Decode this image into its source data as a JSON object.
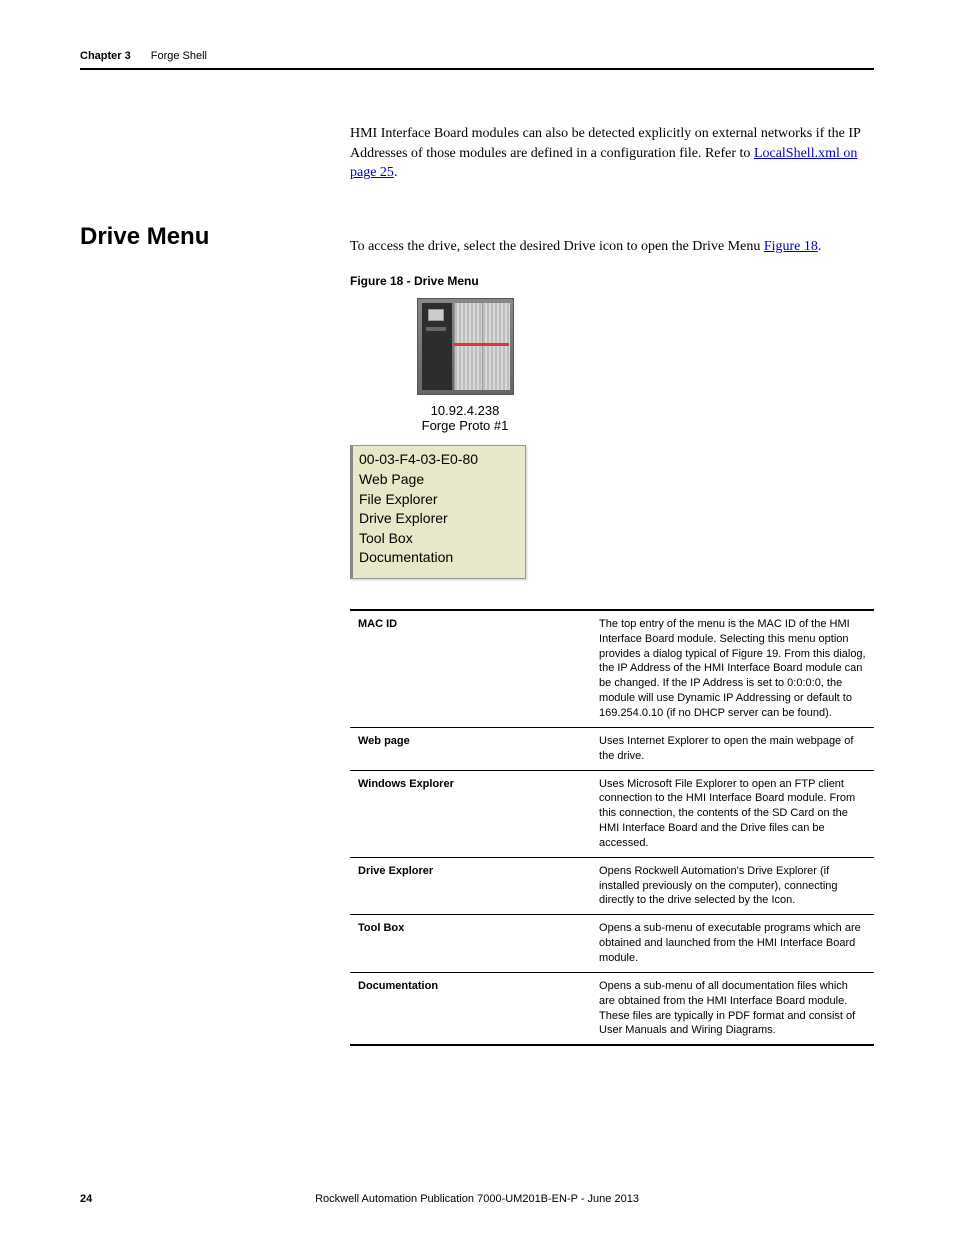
{
  "header": {
    "chapter": "Chapter 3",
    "title": "Forge Shell"
  },
  "intro_para": {
    "before_link": "HMI Interface Board modules can also be detected explicitly on external networks if the IP Addresses of those modules are defined in a configuration file. Refer to ",
    "link": "LocalShell.xml on page 25",
    "after_link": "."
  },
  "section_heading": "Drive Menu",
  "section_intro": {
    "before_link": "To access the drive, select the desired Drive icon to open the Drive Menu ",
    "link": "Figure 18",
    "after_link": "."
  },
  "figure_caption": "Figure 18 - Drive Menu",
  "drive_icon": {
    "ip": "10.92.4.238",
    "name": "Forge Proto #1"
  },
  "context_menu": {
    "items": [
      "00-03-F4-03-E0-80",
      "Web Page",
      "File Explorer",
      "Drive Explorer",
      "Tool Box",
      "Documentation"
    ]
  },
  "table": [
    {
      "term": "MAC ID",
      "desc": "The top entry of the menu is the MAC ID of the HMI Interface Board module. Selecting this menu option provides a dialog typical of Figure 19. From this dialog, the IP Address of the HMI Interface Board module can be changed. If the IP Address is set to 0:0:0:0, the module will use Dynamic IP Addressing or default to 169.254.0.10 (if no DHCP server can be found)."
    },
    {
      "term": "Web page",
      "desc": "Uses Internet Explorer to open the main webpage of the drive."
    },
    {
      "term": "Windows Explorer",
      "desc": "Uses Microsoft File Explorer to open an FTP client connection to the HMI Interface Board module. From this connection, the contents of the SD Card on the HMI Interface Board and the Drive files can be accessed."
    },
    {
      "term": "Drive Explorer",
      "desc": "Opens Rockwell Automation's Drive Explorer (if installed previously on the computer), connecting directly to the drive selected by the Icon."
    },
    {
      "term": "Tool Box",
      "desc": "Opens a sub-menu of executable programs which are obtained and launched from the HMI Interface Board module."
    },
    {
      "term": "Documentation",
      "desc": "Opens a sub-menu of all documentation files which are obtained from the HMI Interface Board module. These files are typically in PDF format and consist of User Manuals and Wiring Diagrams."
    }
  ],
  "footer": {
    "page": "24",
    "pub": "Rockwell Automation Publication 7000-UM201B-EN-P - June 2013"
  }
}
